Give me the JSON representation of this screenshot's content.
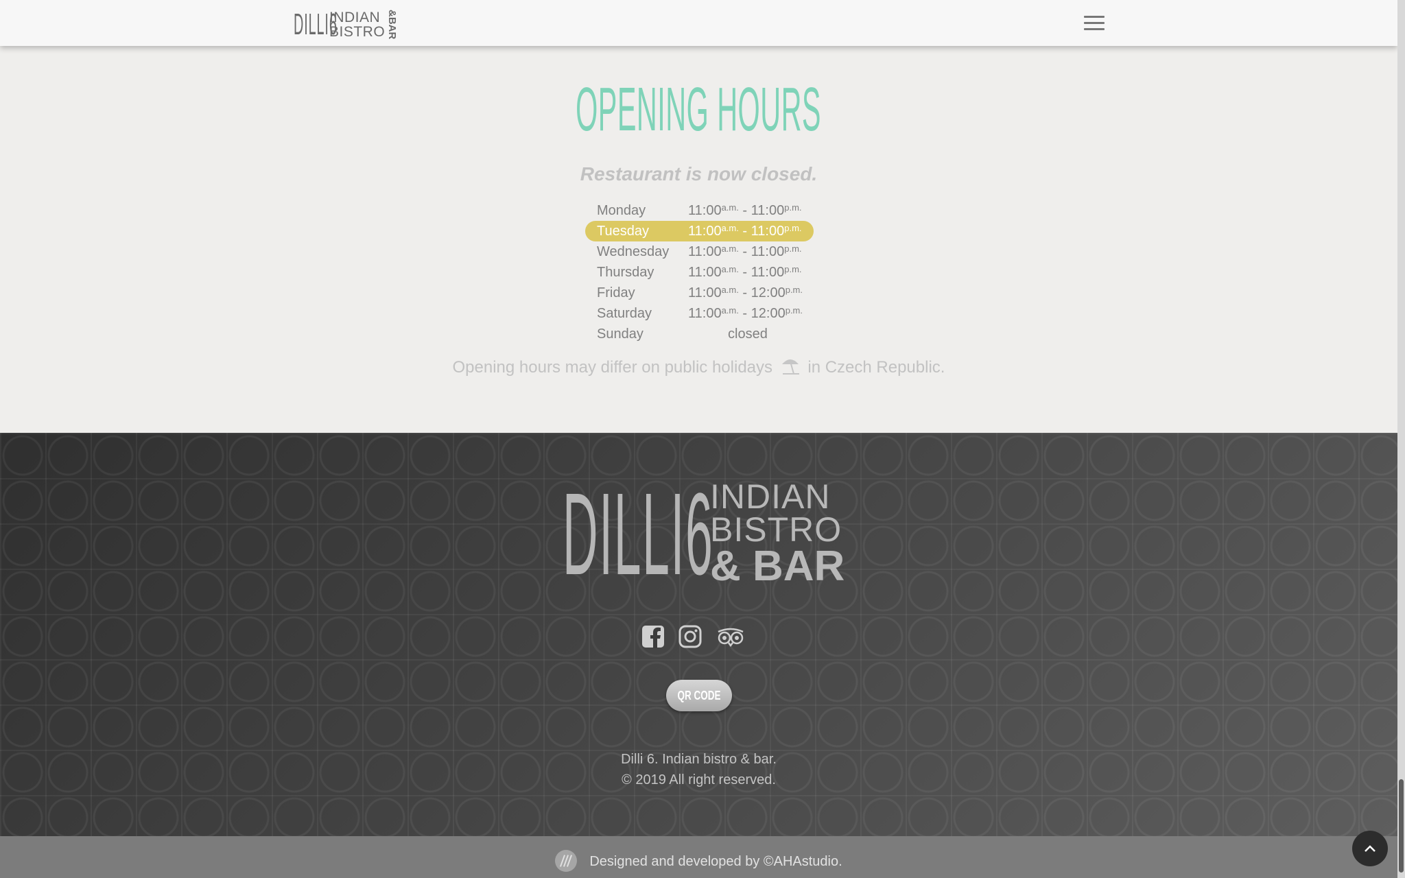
{
  "header": {
    "logo_big": "DILLI6",
    "logo_line1": "INDIAN",
    "logo_line2": "BISTRO",
    "logo_vertical": "&BAR",
    "menu_icon": "hamburger-icon"
  },
  "opening_hours": {
    "title": "OPENING HOURS",
    "status": "Restaurant is now closed.",
    "days": [
      {
        "day": "Monday",
        "open": "11:00",
        "open_suffix": "a.m.",
        "dash": " - ",
        "close": "11:00",
        "close_suffix": "p.m."
      },
      {
        "day": "Tuesday",
        "open": "11:00",
        "open_suffix": "a.m.",
        "dash": " - ",
        "close": "11:00",
        "close_suffix": "p.m."
      },
      {
        "day": "Wednesday",
        "open": "11:00",
        "open_suffix": "a.m.",
        "dash": " - ",
        "close": "11:00",
        "close_suffix": "p.m."
      },
      {
        "day": "Thursday",
        "open": "11:00",
        "open_suffix": "a.m.",
        "dash": " - ",
        "close": "11:00",
        "close_suffix": "p.m."
      },
      {
        "day": "Friday",
        "open": "11:00",
        "open_suffix": "a.m.",
        "dash": " - ",
        "close": "12:00",
        "close_suffix": "p.m."
      },
      {
        "day": "Saturday",
        "open": "11:00",
        "open_suffix": "a.m.",
        "dash": " - ",
        "close": "12:00",
        "close_suffix": "p.m."
      },
      {
        "day": "Sunday",
        "closed": "closed"
      }
    ],
    "highlight_color": "#dcc962",
    "holiday_before": "Opening hours may differ on public holidays",
    "holiday_icon": "beach-umbrella-icon",
    "holiday_after": "in Czech Republic."
  },
  "footer": {
    "logo_big": "DILLI6",
    "logo_line1": "INDIAN",
    "logo_line2": "BISTRO",
    "logo_line3": "& BAR",
    "social_icons": [
      "facebook-icon",
      "instagram-icon",
      "tripadvisor-icon"
    ],
    "qr_button": "QR CODE",
    "line1": "Dilli 6. Indian bistro & bar.",
    "line2": "© 2019 All right reserved."
  },
  "bottom": {
    "credit": "Designed and developed by ©AHAstudio.",
    "to_top_icon": "chevron-up-icon"
  },
  "colors": {
    "accent": "#7fd3b8",
    "footer_bg": "#3c3c3c",
    "bottom_bg": "#7c7c7c"
  }
}
